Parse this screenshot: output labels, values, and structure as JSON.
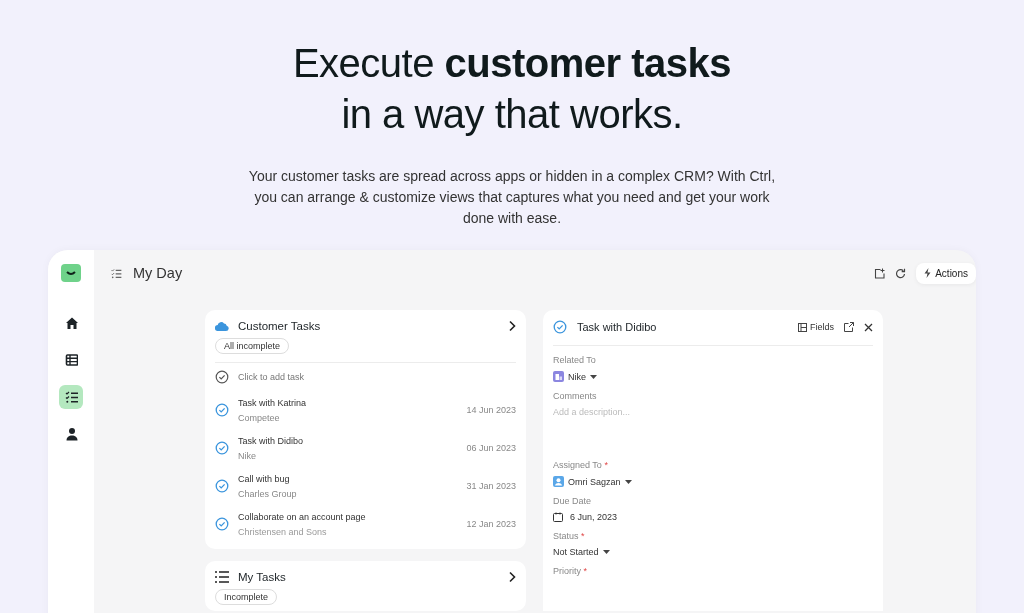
{
  "hero": {
    "headline_lines": [
      "Execute **customer tasks**",
      "in a way that works."
    ],
    "subtitle": "Your customer tasks are spread across apps or hidden in a complex CRM? With Ctrl, you can arrange & customize views that captures what you need and get your work done with ease."
  },
  "sidebar": {
    "items": [
      {
        "kind": "home",
        "selected": false
      },
      {
        "kind": "table",
        "selected": false
      },
      {
        "kind": "checklist",
        "selected": true
      },
      {
        "kind": "person",
        "selected": false
      }
    ]
  },
  "header": {
    "title": "My Day",
    "actions_button": "Actions"
  },
  "customer_tasks": {
    "title": "Customer Tasks",
    "filter": "All incomplete",
    "add_task": "Click to add task",
    "tasks": [
      {
        "title": "Task with Katrina",
        "account": "Competee",
        "date": "14 Jun 2023"
      },
      {
        "title": "Task with Didibo",
        "account": "Nike",
        "date": "06 Jun 2023"
      },
      {
        "title": "Call with bug",
        "account": "Charles Group",
        "date": "31 Jan 2023"
      },
      {
        "title": "Collaborate on an account page",
        "account": "Christensen and Sons",
        "date": "12 Jan 2023"
      }
    ]
  },
  "my_tasks": {
    "title": "My Tasks",
    "filter": "Incomplete"
  },
  "detail": {
    "title": "Task with Didibo",
    "fields_button": "Fields",
    "fields": [
      {
        "kind": "account",
        "label": "Related To",
        "value": "Nike"
      },
      {
        "kind": "textarea",
        "label": "Comments",
        "placeholder": "Add a description..."
      },
      {
        "kind": "user",
        "label": "Assigned To",
        "mark": "*",
        "value": "Omri Sagzan"
      },
      {
        "kind": "date",
        "label": "Due Date",
        "value": "6 Jun, 2023"
      },
      {
        "kind": "select",
        "label": "Status",
        "mark": "*",
        "value": "Not Started"
      },
      {
        "kind": "label",
        "label": "Priority",
        "mark": "*"
      }
    ]
  }
}
